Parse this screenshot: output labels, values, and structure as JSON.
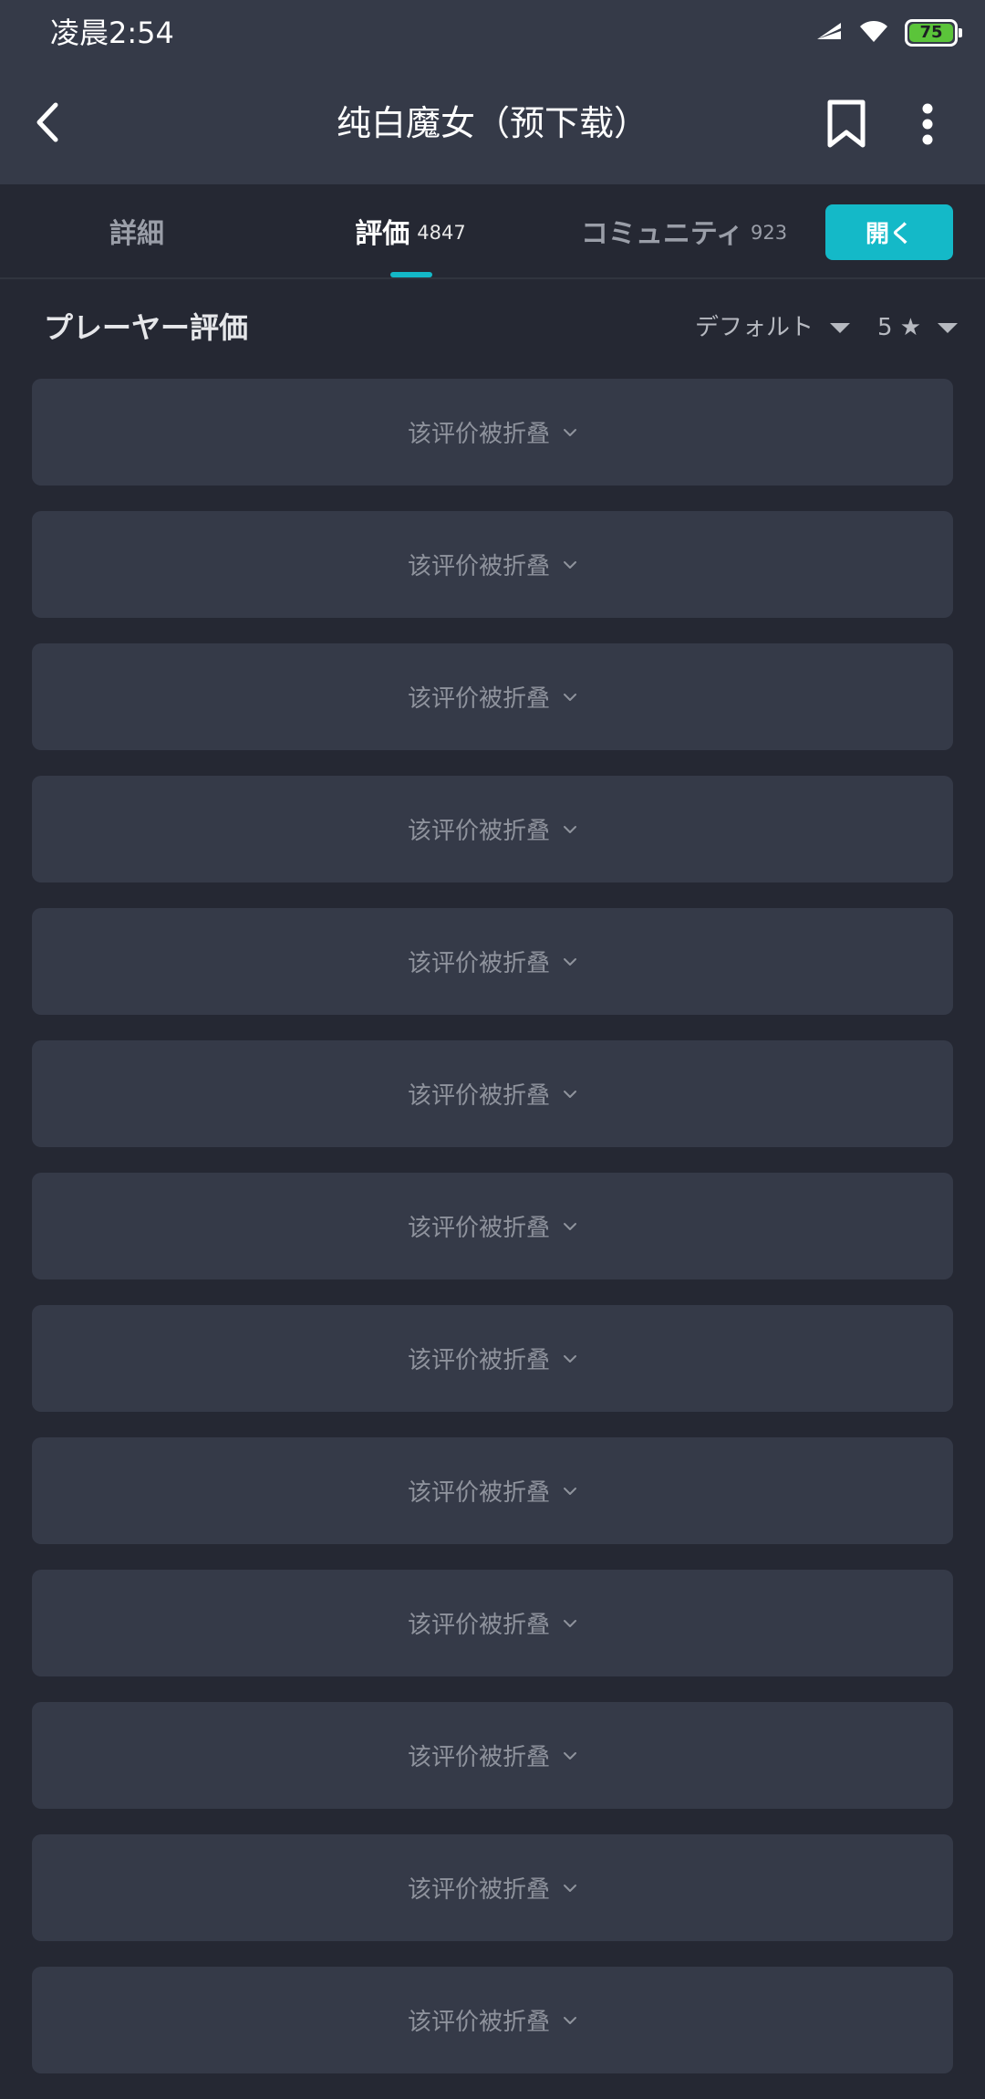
{
  "status_bar": {
    "time": "凌晨2:54",
    "battery": "75",
    "battery_color": "#5bc43a"
  },
  "header": {
    "title": "纯白魔女（预下载）",
    "icons": [
      "back-icon",
      "bookmark-icon",
      "more-vertical-icon"
    ]
  },
  "tabs": [
    {
      "label": "詳細",
      "count": ""
    },
    {
      "label": "評価",
      "count": "4847"
    },
    {
      "label": "コミュニティ",
      "count": "923"
    }
  ],
  "open_button": "開く",
  "accent_color": "#14b9c8",
  "reviews": {
    "title": "プレーヤー評価",
    "sort": "デフォルト",
    "star_filter": "5 ★",
    "collapsed_label": "该评价被折叠",
    "items": [
      "该评价被折叠",
      "该评价被折叠",
      "该评价被折叠",
      "该评价被折叠",
      "该评价被折叠",
      "该评价被折叠",
      "该评价被折叠",
      "该评价被折叠",
      "该评价被折叠",
      "该评价被折叠",
      "该评价被折叠",
      "该评价被折叠",
      "该评价被折叠"
    ]
  }
}
